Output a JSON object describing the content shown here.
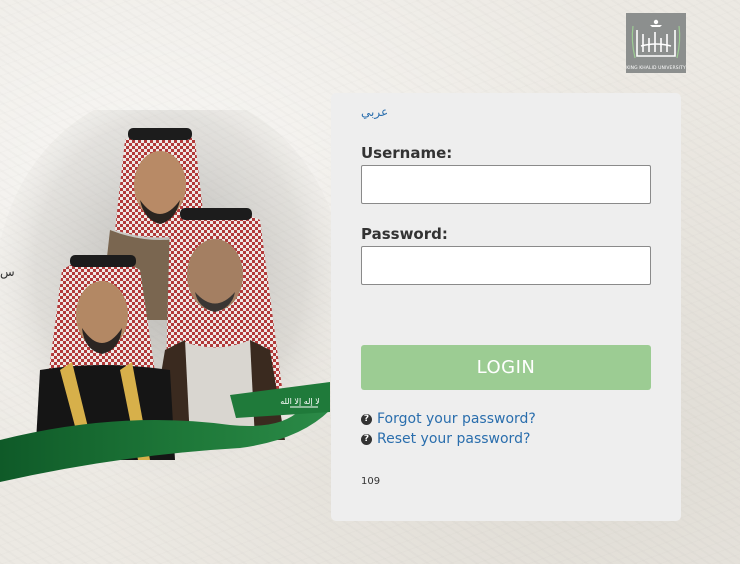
{
  "logo": {
    "caption": "KING KHALID UNIVERSITY",
    "brand_color": "#8c8f8e"
  },
  "hero": {
    "ribbon_color": "#1f7a3a",
    "ribbon_text": "لا إله إلا الله"
  },
  "side_marks": "س",
  "form": {
    "language_link": "عربي",
    "username_label": "Username:",
    "username_value": "",
    "password_label": "Password:",
    "password_value": "",
    "login_button": "LOGIN",
    "login_color": "#9ccc93",
    "forgot_password": "Forgot your password?",
    "reset_password": "Reset your password?",
    "help_icon": "question-circle-icon",
    "version": "109"
  }
}
